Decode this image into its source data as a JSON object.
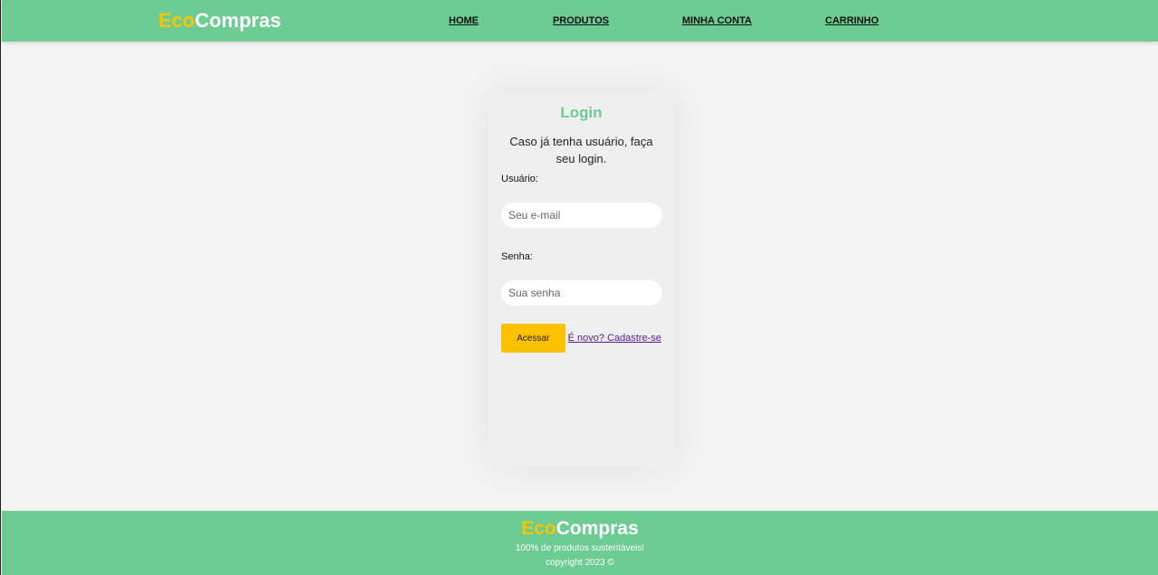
{
  "header": {
    "brand_eco": "Eco",
    "brand_compras": "Compras",
    "nav": [
      "HOME",
      "PRODUTOS",
      "MINHA CONTA",
      "CARRINHO"
    ]
  },
  "login": {
    "title": "Login",
    "subtitle": "Caso já tenha usuário, faça seu login.",
    "user_label": "Usuário:",
    "user_placeholder": "Seu e-mail",
    "user_value": "",
    "pass_label": "Senha:",
    "pass_placeholder": "Sua senha",
    "pass_value": "",
    "submit_label": "Acessar",
    "signup_link": "É novo? Cadastre-se"
  },
  "footer": {
    "brand_eco": "Eco",
    "brand_compras": "Compras",
    "tagline": "100% de produtos sustentáveis!",
    "copyright": "copyright 2023 ©"
  },
  "colors": {
    "primary_green": "#6ccc93",
    "accent_yellow": "#fcc200",
    "brand_yellow": "#f7c600",
    "background": "#f4f4f4",
    "card": "#efefef",
    "link_visited": "#551a8b"
  }
}
